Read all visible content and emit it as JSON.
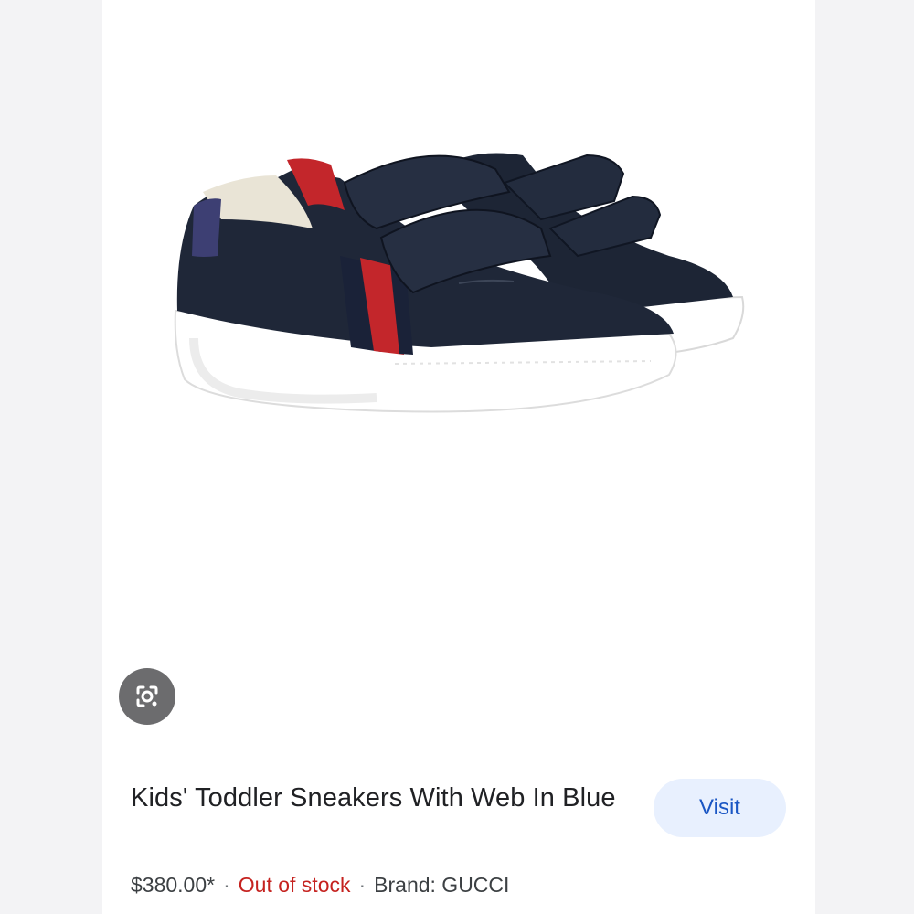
{
  "product": {
    "title": "Kids' Toddler Sneakers With Web In Blue",
    "price": "$380.00*",
    "availability": "Out of stock",
    "brand": "Brand: GUCCI",
    "separator": "·",
    "image_alt": "Navy leather toddler sneakers with red and blue web stripe and double velcro straps"
  },
  "actions": {
    "visit_label": "Visit",
    "lens_icon": "google-lens-icon"
  },
  "colors": {
    "visit_bg": "#e8f0fe",
    "visit_text": "#1a56c4",
    "out_of_stock": "#c5221f",
    "lens_bg": "#6c6c6e"
  }
}
